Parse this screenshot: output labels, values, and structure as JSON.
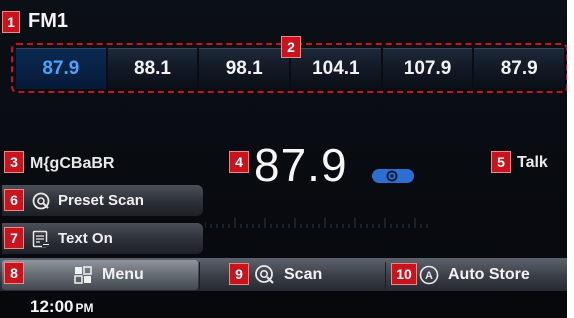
{
  "band": "FM1",
  "presets": [
    "87.9",
    "88.1",
    "98.1",
    "104.1",
    "107.9",
    "87.9"
  ],
  "station_name": "M{gCBaBR",
  "frequency": "87.9",
  "program_type": "Talk",
  "side_buttons": {
    "preset_scan": "Preset Scan",
    "text_on": "Text On"
  },
  "bottom_buttons": {
    "menu": "Menu",
    "scan": "Scan",
    "auto_store": "Auto Store"
  },
  "clock": {
    "time": "12:00",
    "ampm": "PM"
  },
  "callouts": [
    "1",
    "2",
    "3",
    "4",
    "5",
    "6",
    "7",
    "8",
    "9",
    "10"
  ],
  "colors": {
    "callout": "#c8141c",
    "active_preset": "#4aa3ff",
    "hd_indicator": "#2c6fd0"
  },
  "icons": {
    "preset_scan": "scan-circle-icon",
    "text_on": "text-on-icon",
    "menu": "grid-icon",
    "scan": "scan-icon",
    "auto_store": "auto-store-icon",
    "hd": "hd-radio-icon"
  }
}
